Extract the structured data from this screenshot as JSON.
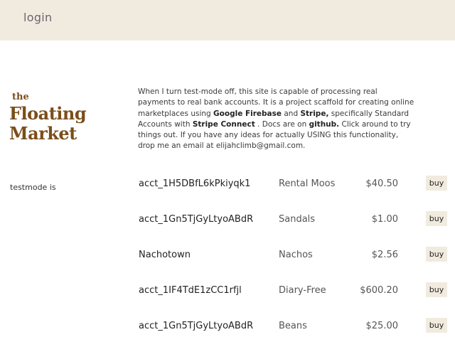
{
  "header": {
    "login_label": "login"
  },
  "logo": {
    "line1": "the",
    "line2": "Floating",
    "line3": "Market"
  },
  "testmode_label": "testmode is",
  "intro": {
    "t1": "When I turn test-mode off, this site is capable of processing real payments to real bank accounts. It is a project scaffold for creating online marketplaces using ",
    "b1": "Google Firebase",
    "t2": " and ",
    "b2": "Stripe,",
    "t3": " specifically Standard Accounts with ",
    "b3": "Stripe Connect",
    "t4": " . Docs are on ",
    "b4": "github.",
    "t5": " Click around to try things out. If you have any ideas for actually USING this functionality, drop me an email at elijahclimb@gmail.com."
  },
  "listings": [
    {
      "account": "acct_1H5DBfL6kPkiyqk1",
      "item": "Rental Moos",
      "price": "$40.50",
      "buy_label": "buy"
    },
    {
      "account": "acct_1Gn5TjGyLtyoABdR",
      "item": "Sandals",
      "price": "$1.00",
      "buy_label": "buy"
    },
    {
      "account": "Nachotown",
      "item": "Nachos",
      "price": "$2.56",
      "buy_label": "buy"
    },
    {
      "account": "acct_1IF4TdE1zCC1rfjl",
      "item": "Diary-Free",
      "price": "$600.20",
      "buy_label": "buy"
    },
    {
      "account": "acct_1Gn5TjGyLtyoABdR",
      "item": "Beans",
      "price": "$25.00",
      "buy_label": "buy"
    }
  ]
}
